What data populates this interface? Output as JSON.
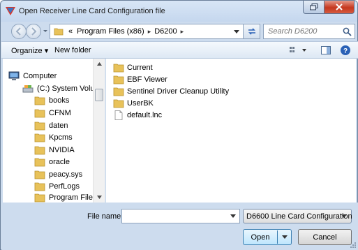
{
  "window": {
    "title": "Open Receiver Line Card Configuration file"
  },
  "address": {
    "overflow": "«",
    "crumbs": [
      "Program Files (x86)",
      "D6200"
    ],
    "separator": "▸"
  },
  "search": {
    "placeholder": "Search D6200"
  },
  "toolbar": {
    "organize_label": "Organize ▾",
    "new_folder_label": "New folder"
  },
  "nav": {
    "computer_label": "Computer",
    "drive_label": "(C:) System Volu",
    "folders": [
      "books",
      "CFNM",
      "daten",
      "Kpcms",
      "NVIDIA",
      "oracle",
      "peacy.sys",
      "PerfLogs",
      "Program Files"
    ]
  },
  "files": [
    {
      "name": "Current",
      "type": "folder"
    },
    {
      "name": "EBF Viewer",
      "type": "folder"
    },
    {
      "name": "Sentinel Driver Cleanup Utility",
      "type": "folder"
    },
    {
      "name": "UserBK",
      "type": "folder"
    },
    {
      "name": "default.lnc",
      "type": "file"
    }
  ],
  "bottom": {
    "file_name_label": "File name:",
    "file_name_value": "",
    "file_type_value": "D6600 Line Card Configuration",
    "open_label": "Open",
    "cancel_label": "Cancel"
  },
  "colors": {
    "folder": "#e8c25a",
    "accent": "#2a61b6",
    "close": "#c5371e"
  }
}
